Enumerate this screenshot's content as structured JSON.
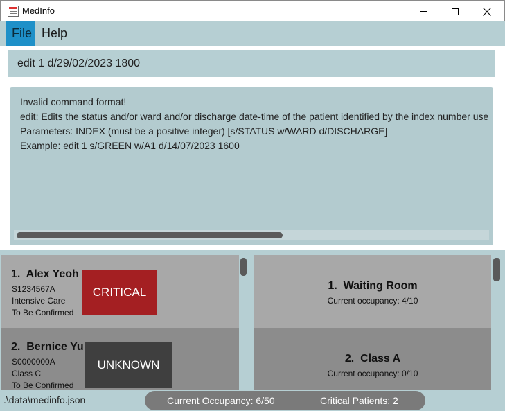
{
  "window": {
    "title": "MedInfo"
  },
  "menu": {
    "items": [
      {
        "label": "File"
      },
      {
        "label": "Help"
      }
    ]
  },
  "command": {
    "value": "edit 1 d/29/02/2023 1800"
  },
  "result": {
    "lines": [
      "Invalid command format!",
      "edit: Edits the status and/or ward and/or discharge date-time of the patient identified by the index number use",
      "Parameters: INDEX (must be a positive integer) [s/STATUS w/WARD d/DISCHARGE]",
      "Example: edit 1 s/GREEN w/A1 d/14/07/2023 1600"
    ]
  },
  "patients": [
    {
      "index": "1.",
      "name": "Alex Yeoh",
      "nric": "S1234567A",
      "ward": "Intensive Care",
      "discharge": "To Be Confirmed",
      "status": "CRITICAL",
      "status_color": "#a41f22"
    },
    {
      "index": "2.",
      "name": "Bernice Yu",
      "nric": "S0000000A",
      "ward": "Class C",
      "discharge": "To Be Confirmed",
      "status": "UNKNOWN",
      "status_color": "#3f3f3f"
    }
  ],
  "wards": [
    {
      "index": "1.",
      "name": "Waiting Room",
      "occupancy": "Current occupancy: 4/10"
    },
    {
      "index": "2.",
      "name": "Class A",
      "occupancy": "Current occupancy: 0/10"
    }
  ],
  "status_bar": {
    "path": ".\\data\\medinfo.json",
    "occupancy": "Current Occupancy: 6/50",
    "critical": "Critical Patients: 2"
  },
  "colors": {
    "accent": "#1e90c8",
    "panel_bg": "#b6cfd3",
    "critical": "#a41f22",
    "unknown": "#3f3f3f"
  },
  "icons": [
    "app-icon",
    "minimize-icon",
    "maximize-icon",
    "close-icon"
  ]
}
